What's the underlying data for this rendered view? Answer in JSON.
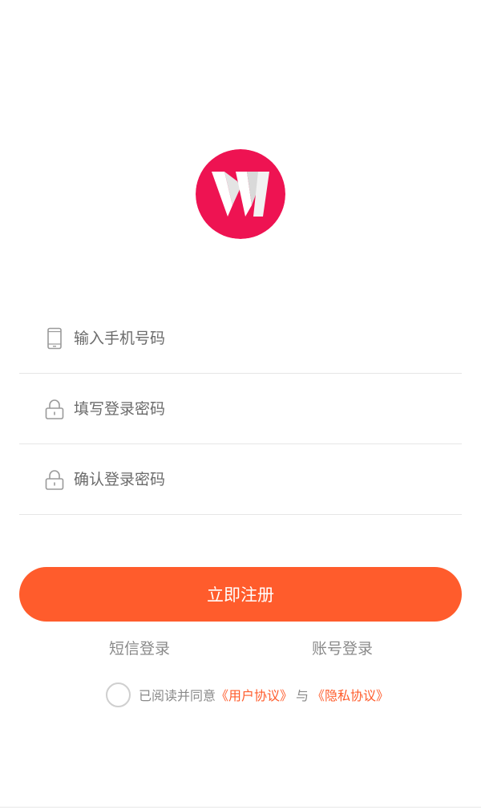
{
  "fields": {
    "phone": {
      "placeholder": "输入手机号码",
      "value": "",
      "icon": "phone-icon"
    },
    "password": {
      "placeholder": "填写登录密码",
      "value": "",
      "icon": "lock-icon"
    },
    "confirm": {
      "placeholder": "确认登录密码",
      "value": "",
      "icon": "lock-icon"
    }
  },
  "register_button": "立即注册",
  "links": {
    "sms_login": "短信登录",
    "account_login": "账号登录"
  },
  "agreement": {
    "prefix": "已阅读并同意",
    "user_agreement": "《用户协议》",
    "conjunction": "与",
    "privacy_agreement": "《隐私协议》",
    "checked": false
  },
  "colors": {
    "accent": "#ff5c2c",
    "logo": "#ee1352"
  }
}
